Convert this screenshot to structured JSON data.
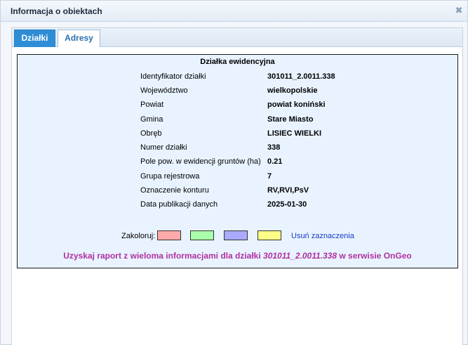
{
  "window": {
    "title": "Informacja o obiektach",
    "close_symbol": "✖"
  },
  "tabs": [
    {
      "label": "Działki",
      "active": true
    },
    {
      "label": "Adresy",
      "active": false
    }
  ],
  "parcel": {
    "heading": "Działka ewidencyjna",
    "attributes": [
      {
        "label": "Identyfikator działki",
        "value": "301011_2.0011.338"
      },
      {
        "label": "Województwo",
        "value": "wielkopolskie"
      },
      {
        "label": "Powiat",
        "value": "powiat koniński"
      },
      {
        "label": "Gmina",
        "value": "Stare Miasto"
      },
      {
        "label": "Obręb",
        "value": "LISIEC WIELKI"
      },
      {
        "label": "Numer działki",
        "value": "338"
      },
      {
        "label": "Pole pow. w ewidencji gruntów (ha)",
        "value": "0.21"
      },
      {
        "label": "Grupa rejestrowa",
        "value": "7"
      },
      {
        "label": "Oznaczenie konturu",
        "value": "RV,RVI,PsV"
      },
      {
        "label": "Data publikacji danych",
        "value": "2025-01-30"
      }
    ]
  },
  "coloring": {
    "label": "Zakoloruj:",
    "swatches": [
      "#ffaaaa",
      "#aaffaa",
      "#aaaaff",
      "#ffff88"
    ],
    "clear_label": "Usuń zaznaczenia"
  },
  "report": {
    "prefix": "Uzyskaj raport z wieloma informacjami dla działki ",
    "parcel_id": "301011_2.0011.338",
    "suffix": " w serwisie OnGeo"
  }
}
